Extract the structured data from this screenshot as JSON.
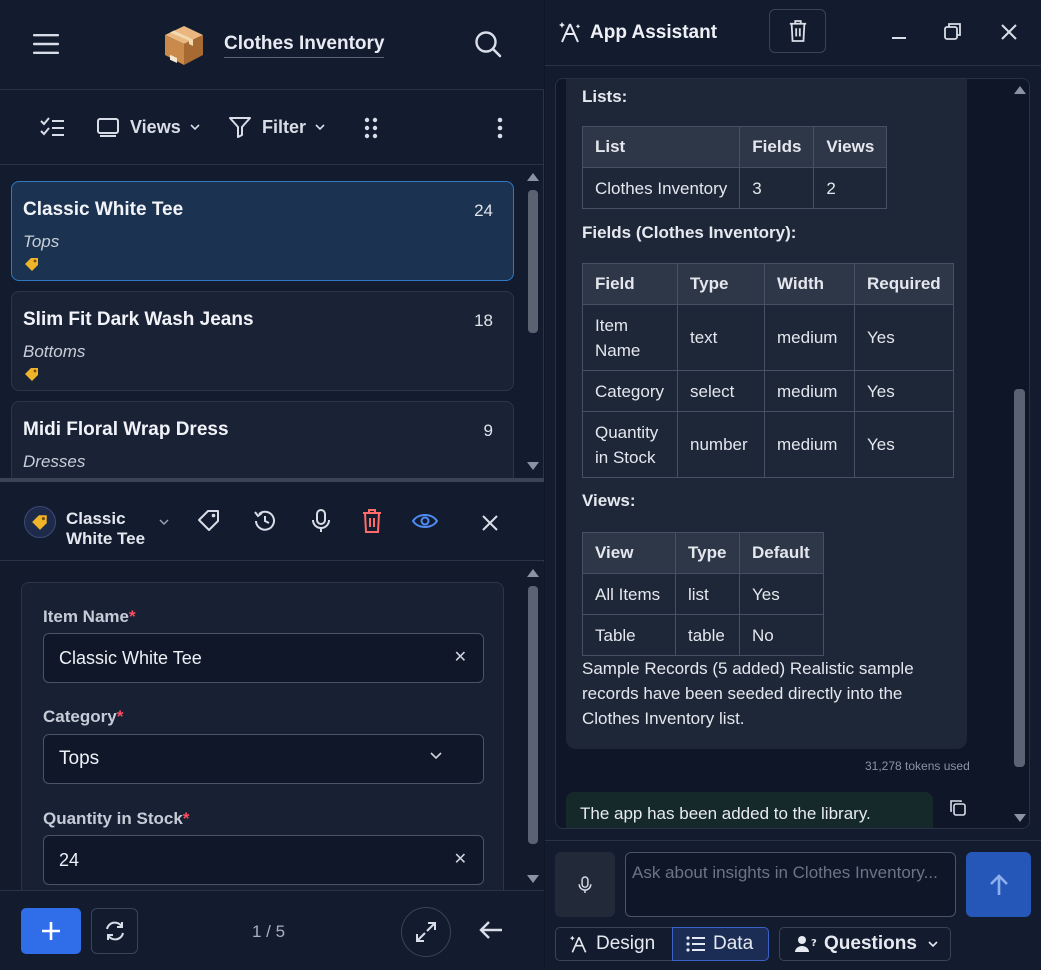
{
  "app": {
    "title": "Clothes Inventory"
  },
  "toolbar": {
    "views_label": "Views",
    "filter_label": "Filter"
  },
  "records": [
    {
      "name": "Classic White Tee",
      "qty": "24",
      "category": "Tops",
      "selected": true
    },
    {
      "name": "Slim Fit Dark Wash Jeans",
      "qty": "18",
      "category": "Bottoms",
      "selected": false
    },
    {
      "name": "Midi Floral Wrap Dress",
      "qty": "9",
      "category": "Dresses",
      "selected": false
    }
  ],
  "record_bar": {
    "current_name": "Classic White Tee"
  },
  "form": {
    "item_name": {
      "label": "Item Name",
      "value": "Classic White Tee"
    },
    "category": {
      "label": "Category",
      "value": "Tops"
    },
    "quantity": {
      "label": "Quantity in Stock",
      "value": "24"
    },
    "required_mark": "*"
  },
  "footer": {
    "pager": "1 / 5"
  },
  "assistant": {
    "title": "App Assistant",
    "lists_heading": "Lists:",
    "lists_table": {
      "headers": [
        "List",
        "Fields",
        "Views"
      ],
      "rows": [
        [
          "Clothes Inventory",
          "3",
          "2"
        ]
      ]
    },
    "fields_heading": "Fields (Clothes Inventory):",
    "fields_table": {
      "headers": [
        "Field",
        "Type",
        "Width",
        "Required"
      ],
      "rows": [
        [
          "Item Name",
          "text",
          "medium",
          "Yes"
        ],
        [
          "Category",
          "select",
          "medium",
          "Yes"
        ],
        [
          "Quantity in Stock",
          "number",
          "medium",
          "Yes"
        ]
      ]
    },
    "views_heading": "Views:",
    "views_table": {
      "headers": [
        "View",
        "Type",
        "Default"
      ],
      "rows": [
        [
          "All Items",
          "list",
          "Yes"
        ],
        [
          "Table",
          "table",
          "No"
        ]
      ]
    },
    "sample_text": "Sample Records (5 added) Realistic sample records have been seeded directly into the Clothes Inventory list.",
    "tokens": "31,278 tokens used",
    "status_message": "The app has been added to the library.",
    "input_placeholder": "Ask about insights in Clothes Inventory...",
    "tabs": {
      "design": "Design",
      "data": "Data",
      "questions": "Questions"
    }
  },
  "colors": {
    "accent": "#2f6ee8",
    "selected_border": "#2f79c4",
    "delete": "#ff6b6b",
    "eye": "#4f8df5",
    "required": "#ff4d5e"
  }
}
